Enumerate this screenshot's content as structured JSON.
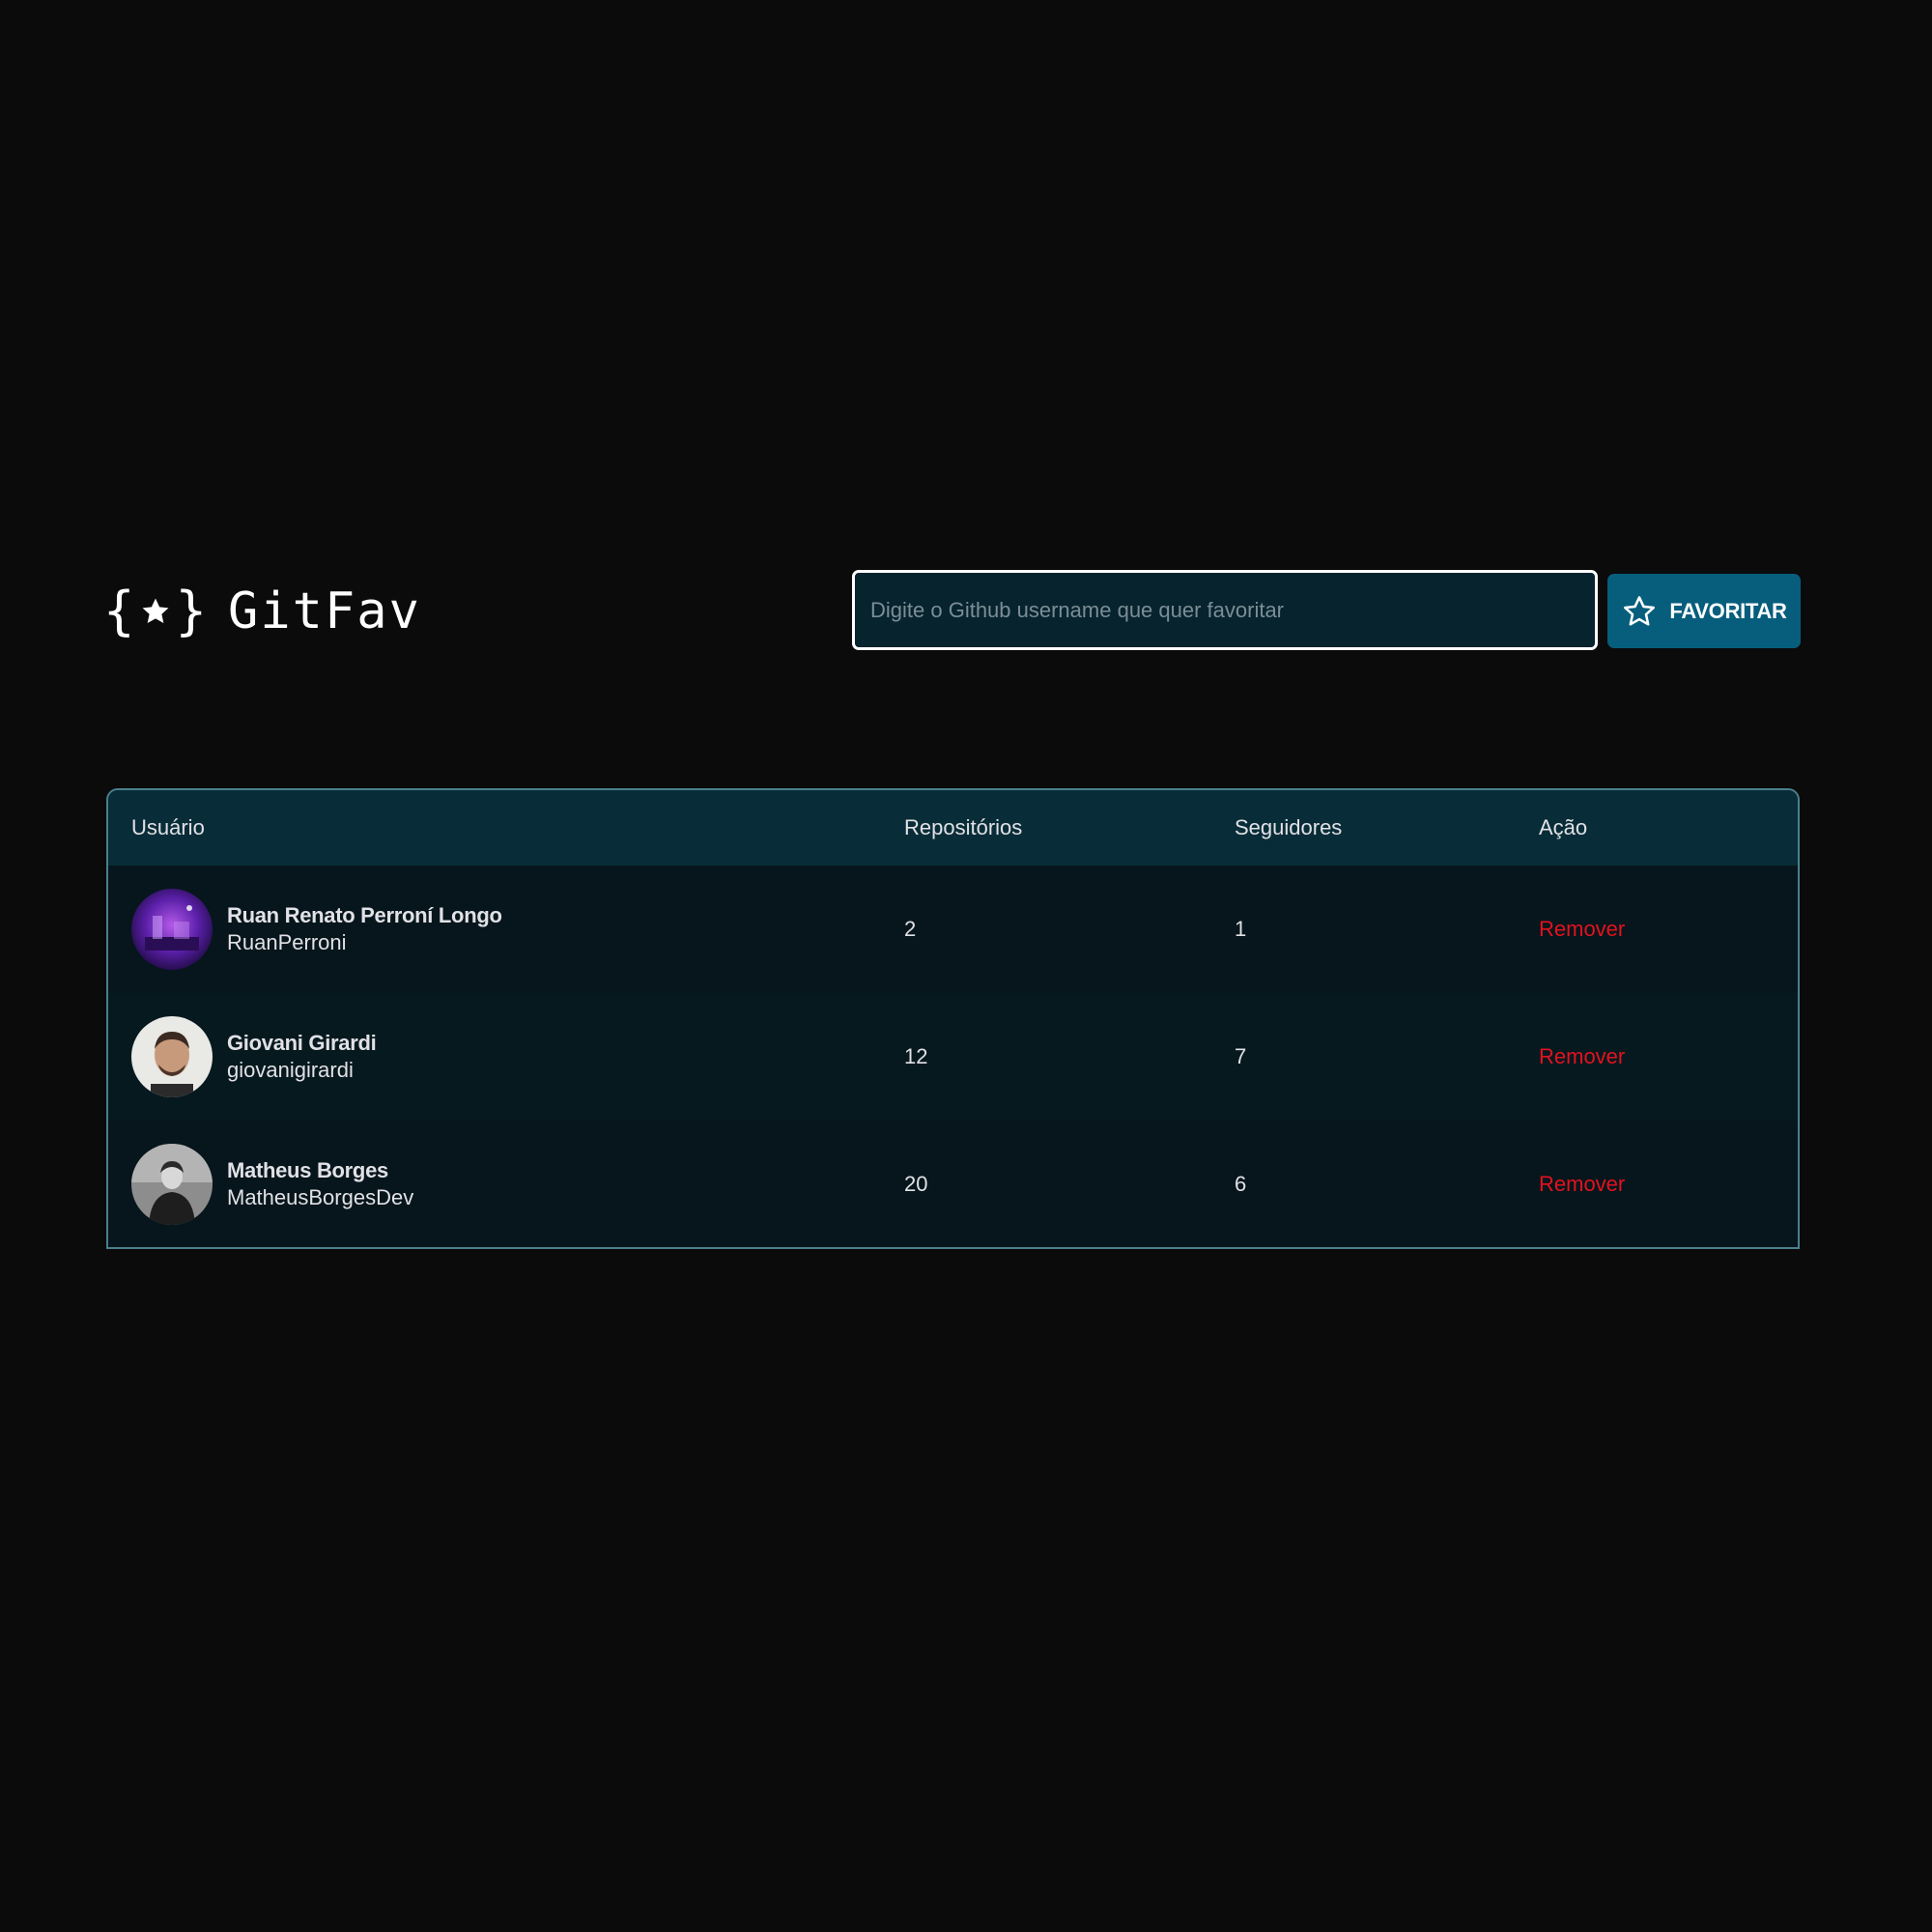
{
  "app": {
    "title": "GitFav",
    "logo_open": "{",
    "logo_close": "}"
  },
  "search": {
    "placeholder": "Digite o Github username que quer favoritar",
    "value": ""
  },
  "favorite_button": {
    "label": "FAVORITAR",
    "icon": "star-outline-icon"
  },
  "table": {
    "headers": {
      "user": "Usuário",
      "repositories": "Repositórios",
      "followers": "Seguidores",
      "action": "Ação"
    },
    "rows": [
      {
        "name": "Ruan Renato Perroní Longo",
        "login": "RuanPerroni",
        "repositories": "2",
        "followers": "1",
        "action": "Remover"
      },
      {
        "name": "Giovani Girardi",
        "login": "giovanigirardi",
        "repositories": "12",
        "followers": "7",
        "action": "Remover"
      },
      {
        "name": "Matheus Borges",
        "login": "MatheusBorgesDev",
        "repositories": "20",
        "followers": "6",
        "action": "Remover"
      }
    ]
  },
  "colors": {
    "background": "#0b0b0c",
    "input_background": "#06232e",
    "button_background": "#065e7c",
    "table_header": "#092d38",
    "table_border": "#4a808c",
    "remove_text": "#e2121e"
  }
}
